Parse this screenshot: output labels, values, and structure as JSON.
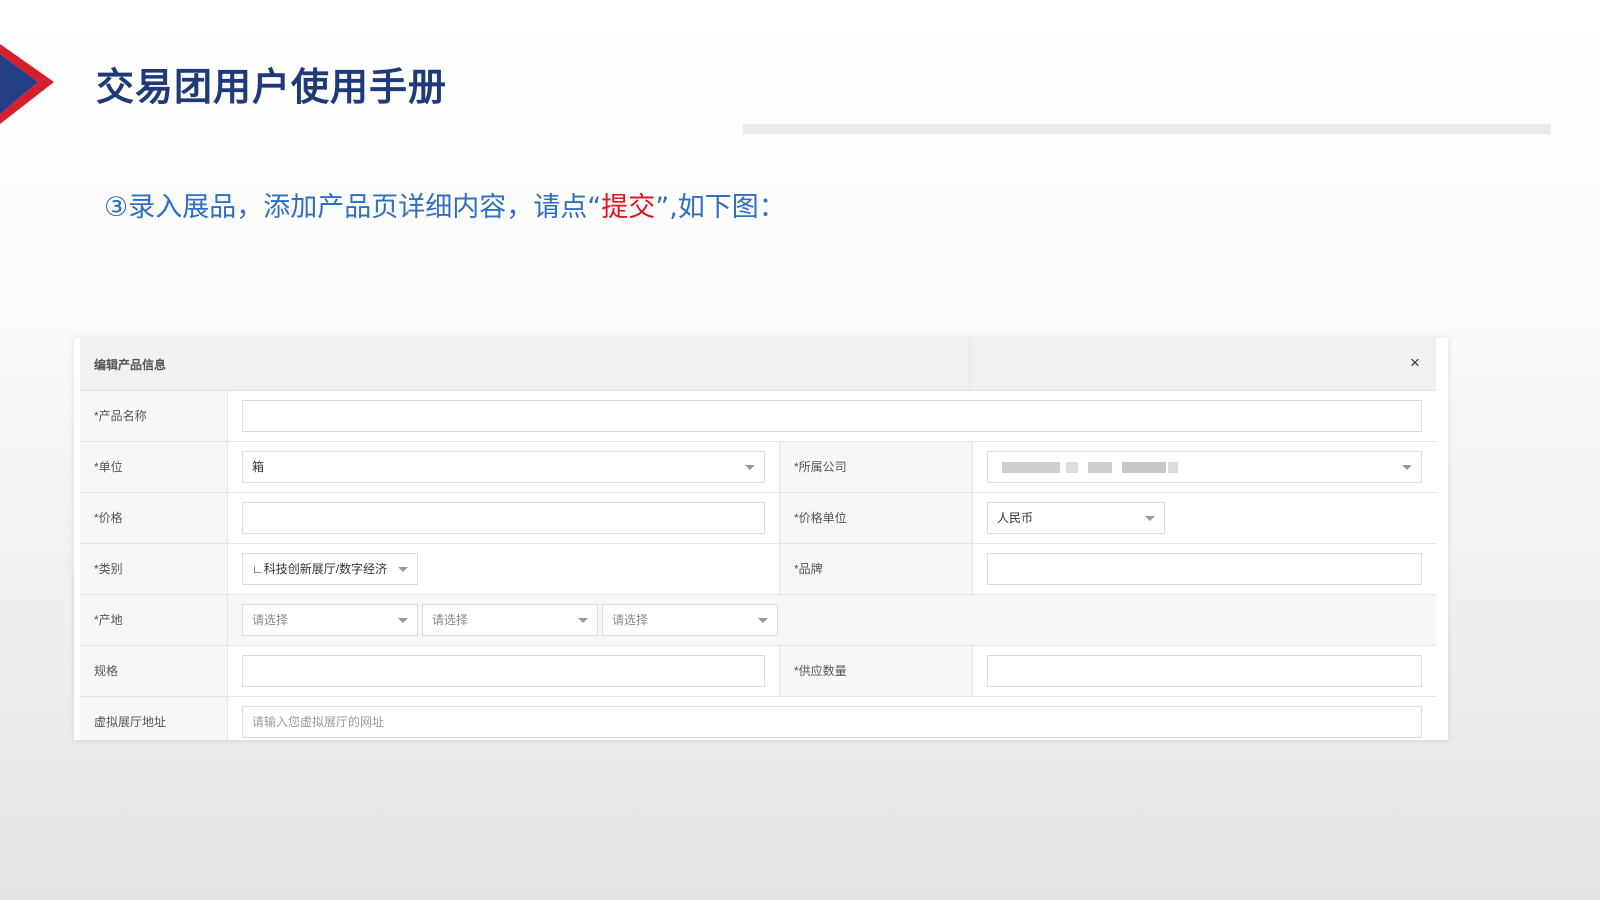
{
  "slide": {
    "title": "交易团用户使用手册",
    "instruction_prefix": "③录入展品，添加产品页详细内容，请点“",
    "instruction_highlight": "提交",
    "instruction_suffix": "”,如下图："
  },
  "colors": {
    "title": "#1f3a78",
    "instruction": "#2f6fc1",
    "highlight": "#e0141e",
    "arrow_red": "#d61f2c",
    "arrow_blue": "#253f86"
  },
  "icons": [
    "chevron-arrow-icon",
    "close-icon",
    "chevron-down-icon"
  ],
  "dialog": {
    "title": "编辑产品信息",
    "close_label": "×",
    "fields": {
      "product_name": {
        "label": "*产品名称",
        "value": ""
      },
      "unit": {
        "label": "*单位",
        "value": "箱"
      },
      "company": {
        "label": "*所属公司",
        "value": ""
      },
      "price": {
        "label": "*价格",
        "value": ""
      },
      "price_unit": {
        "label": "*价格单位",
        "value": "人民币"
      },
      "category": {
        "label": "*类别",
        "value": "∟科技创新展厅/数字经济"
      },
      "brand": {
        "label": "*品牌",
        "value": ""
      },
      "origin": {
        "label": "*产地",
        "selects": [
          "请选择",
          "请选择",
          "请选择"
        ]
      },
      "spec": {
        "label": "规格",
        "value": ""
      },
      "supply_qty": {
        "label": "*供应数量",
        "value": ""
      },
      "virtual_hall": {
        "label": "虚拟展厅地址",
        "placeholder": "请输入您虚拟展厅的网址"
      }
    }
  }
}
